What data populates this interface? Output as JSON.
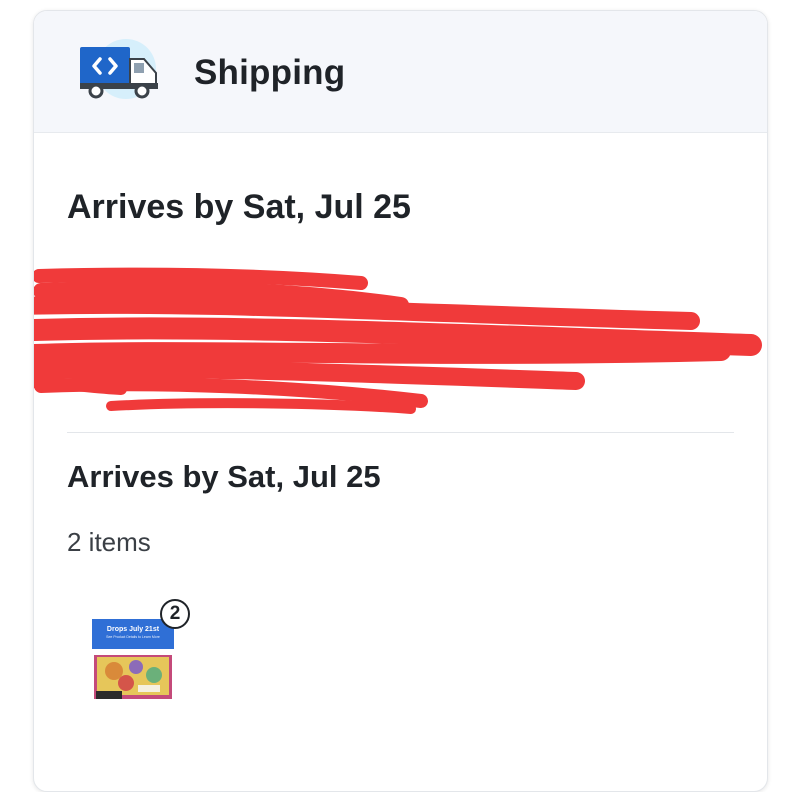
{
  "header": {
    "icon": "delivery-truck-icon",
    "title": "Shipping"
  },
  "shipments": [
    {
      "arrival_text": "Arrives by Sat, Jul 25"
    },
    {
      "arrival_text": "Arrives by Sat, Jul 25",
      "item_count_text": "2 items",
      "items": [
        {
          "thumbnail_banner": "Drops July 21st",
          "thumbnail_subtext": "See Product Details to Learn More",
          "quantity": "2"
        }
      ]
    }
  ],
  "colors": {
    "header_bg": "#f5f7fb",
    "truck_blue": "#1f66c9",
    "redaction_red": "#f03a3a",
    "text_primary": "#1f2328"
  }
}
